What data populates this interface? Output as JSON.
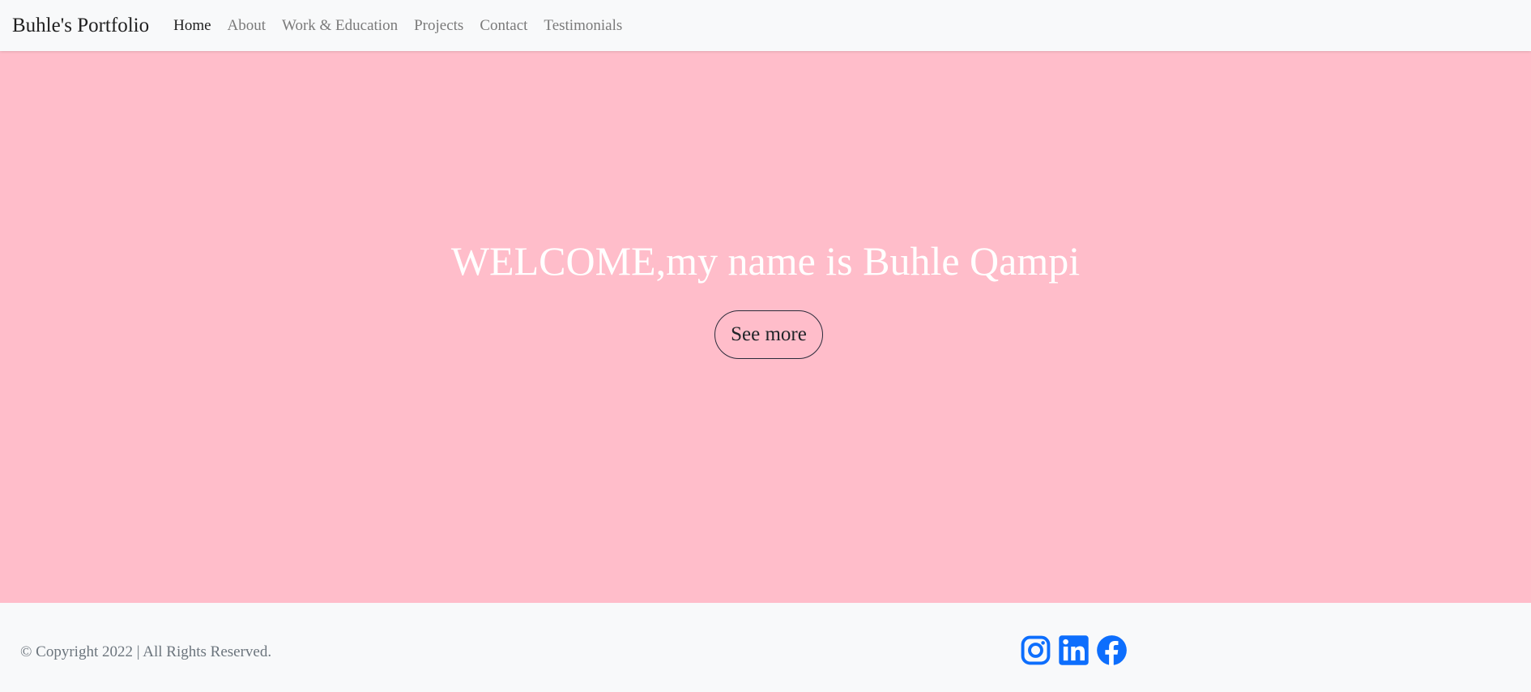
{
  "navbar": {
    "brand": "Buhle's Portfolio",
    "links": [
      {
        "label": "Home",
        "active": true
      },
      {
        "label": "About"
      },
      {
        "label": "Work & Education"
      },
      {
        "label": "Projects"
      },
      {
        "label": "Contact"
      },
      {
        "label": "Testimonials"
      }
    ]
  },
  "hero": {
    "title": "WELCOME,my name is Buhle Qampi",
    "button_label": "See more",
    "background_color": "#ffbdca"
  },
  "footer": {
    "copyright": "© Copyright 2022 | All Rights Reserved.",
    "social_icons": [
      "instagram-icon",
      "linkedin-icon",
      "facebook-icon"
    ],
    "icon_color": "#0d6efd"
  }
}
